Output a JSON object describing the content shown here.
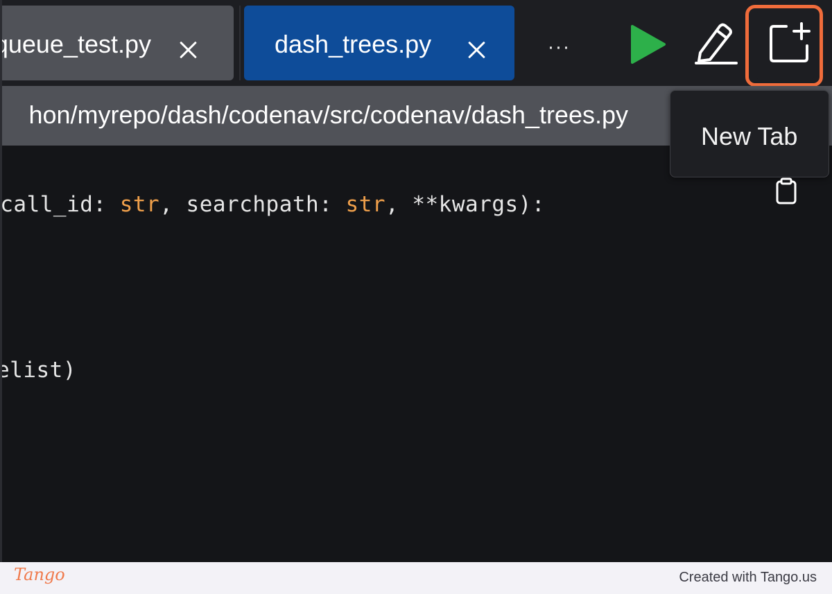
{
  "tabs": [
    {
      "label": "queue_test.py",
      "active": false
    },
    {
      "label": "dash_trees.py",
      "active": true
    }
  ],
  "toolbar": {
    "more_label": "···",
    "run_icon": "play-icon",
    "edit_icon": "pencil-icon",
    "new_tab_icon": "new-tab-icon",
    "highlight_color": "#f06c3b",
    "run_color": "#2db04a"
  },
  "tooltip": {
    "text": "New Tab"
  },
  "path": {
    "text": "hon/myrepo/dash/codenav/src/codenav/dash_trees.py"
  },
  "code": {
    "line1": {
      "seg1": "call_id: ",
      "seg2": "str",
      "seg3": ", searchpath: ",
      "seg4": "str",
      "seg5": ", **kwargs):"
    },
    "line2": "elist)"
  },
  "footer": {
    "brand": "Tango",
    "credit": "Created with Tango.us"
  }
}
